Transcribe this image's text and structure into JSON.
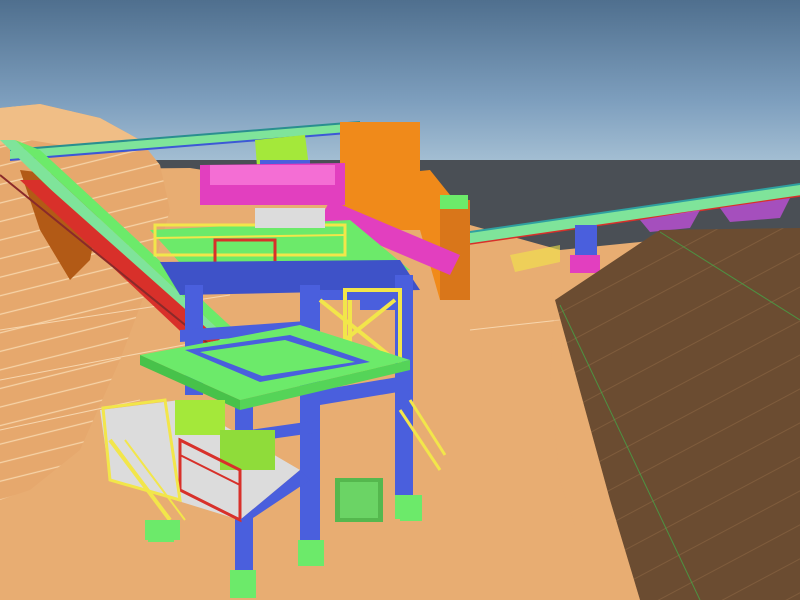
{
  "scene": {
    "subject": "industrial-plant-3d-model",
    "colors": {
      "sky_top": "#4f6f8e",
      "sky_bottom": "#a9c3d6",
      "sea": "#4a4f55",
      "ground": "#e8ad72",
      "stockpile_shadow": "#6b4c31",
      "steel_blue": "#4a5fdd",
      "platform_green": "#6cea6a",
      "handrail_yellow": "#f2e64a",
      "conveyor_magenta": "#e23fbf",
      "tower_orange": "#f08a1a",
      "rail_red": "#d8302a"
    }
  }
}
